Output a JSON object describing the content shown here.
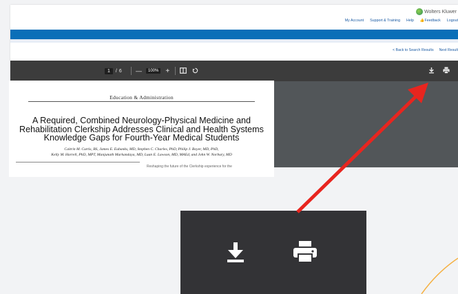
{
  "header": {
    "brand": "Wolters Kluwer",
    "nav": [
      "My Account",
      "Support & Training",
      "Help",
      "Feedback",
      "Logout"
    ]
  },
  "results_nav": {
    "back": "< Back to Search Results",
    "next": "Next Result"
  },
  "pdf_toolbar": {
    "page_current": "1",
    "page_separator": "/",
    "page_total": "6",
    "zoom_out": "—",
    "zoom": "100%",
    "zoom_in": "+",
    "icons": [
      "fit-page-icon",
      "rotate-icon",
      "download-icon",
      "print-icon"
    ]
  },
  "document": {
    "section": "Education & Administration",
    "title": "A Required, Combined Neurology-Physical Medicine and Rehabilitation Clerkship Addresses Clinical and Health Systems Knowledge Gaps for Fourth-Year Medical Students",
    "authors_line1": "Caitrin M. Curtis, BS, James E. Eubanks, MD, Stephen C. Charles, PhD, Philip J. Boyer, MD, PhD,",
    "authors_line2": "Kelly M. Harrell, PhD, MPT, Manjunath Markandaya, MD, Luan E. Lawson, MD, MAEd, and John W. Norbury, MD",
    "col2_text": "Reshaping the future of the Clerkship experience for the"
  },
  "colors": {
    "accent_blue": "#0a6fb8",
    "toolbar": "#3c3c3c",
    "annotation_arrow": "#e8251f",
    "decor_arc": "#f5b041"
  }
}
